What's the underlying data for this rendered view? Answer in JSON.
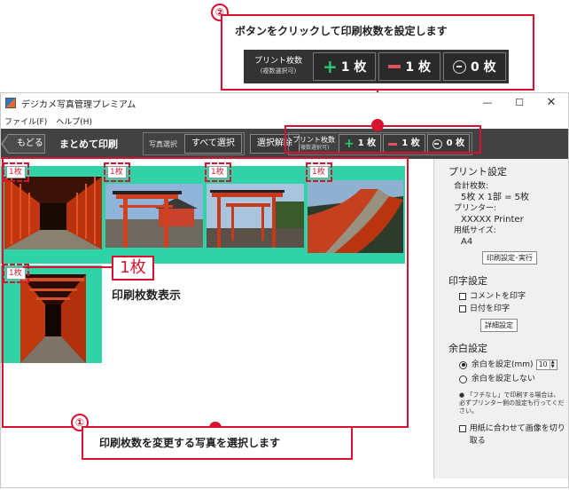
{
  "callout_top": {
    "number": "②",
    "text": "ボタンをクリックして印刷枚数を設定します",
    "label_line1": "プリント枚数",
    "label_line2": "(複数選択可)",
    "plus": "1 枚",
    "minus": "1 枚",
    "zero": "0 枚"
  },
  "window": {
    "title": "デジカメ写真管理プレミアム",
    "min": "—",
    "max": "☐",
    "close": "✕"
  },
  "menu": [
    "ファイル(F)",
    "ヘルプ(H)"
  ],
  "toolbar": {
    "back": "もどる",
    "title": "まとめて印刷",
    "select_label": "写真選択",
    "select_all": "すべて選択",
    "deselect": "選択解除",
    "print_label_line1": "プリント枚数",
    "print_label_line2": "(複数選択可)",
    "plus": "1 枚",
    "minus": "1 枚",
    "zero": "0 枚"
  },
  "photos": {
    "badges": [
      "1枚",
      "1枚",
      "1枚",
      "1枚",
      "1枚"
    ]
  },
  "annotation_count": {
    "badge": "1枚",
    "label": "印刷枚数表示"
  },
  "pane": {
    "print_settings": "プリント設定",
    "total_label": "合計枚数:",
    "total_value": "5枚 X 1部 = 5枚",
    "printer_label": "プリンター:",
    "printer_value": "XXXXX Printer",
    "paper_label": "用紙サイズ:",
    "paper_value": "A4",
    "print_exec": "印刷設定･実行",
    "text_print": "印字設定",
    "comment": "コメントを印字",
    "date": "日付を印字",
    "detail": "詳細設定",
    "margin": "余白設定",
    "margin_set": "余白を設定(mm)",
    "margin_value": "10",
    "margin_none": "余白を設定しない",
    "note": "「フチなし」で印刷する場合は、必ずプリンター側の設定も行ってください。",
    "fit": "用紙に合わせて画像を切り取る"
  },
  "callout_bottom": {
    "number": "①",
    "text": "印刷枚数を変更する写真を選択します"
  },
  "colors": {
    "accent": "#d8112f",
    "selection_bg": "#2fd3a7",
    "toolbar_bg": "#424242"
  }
}
